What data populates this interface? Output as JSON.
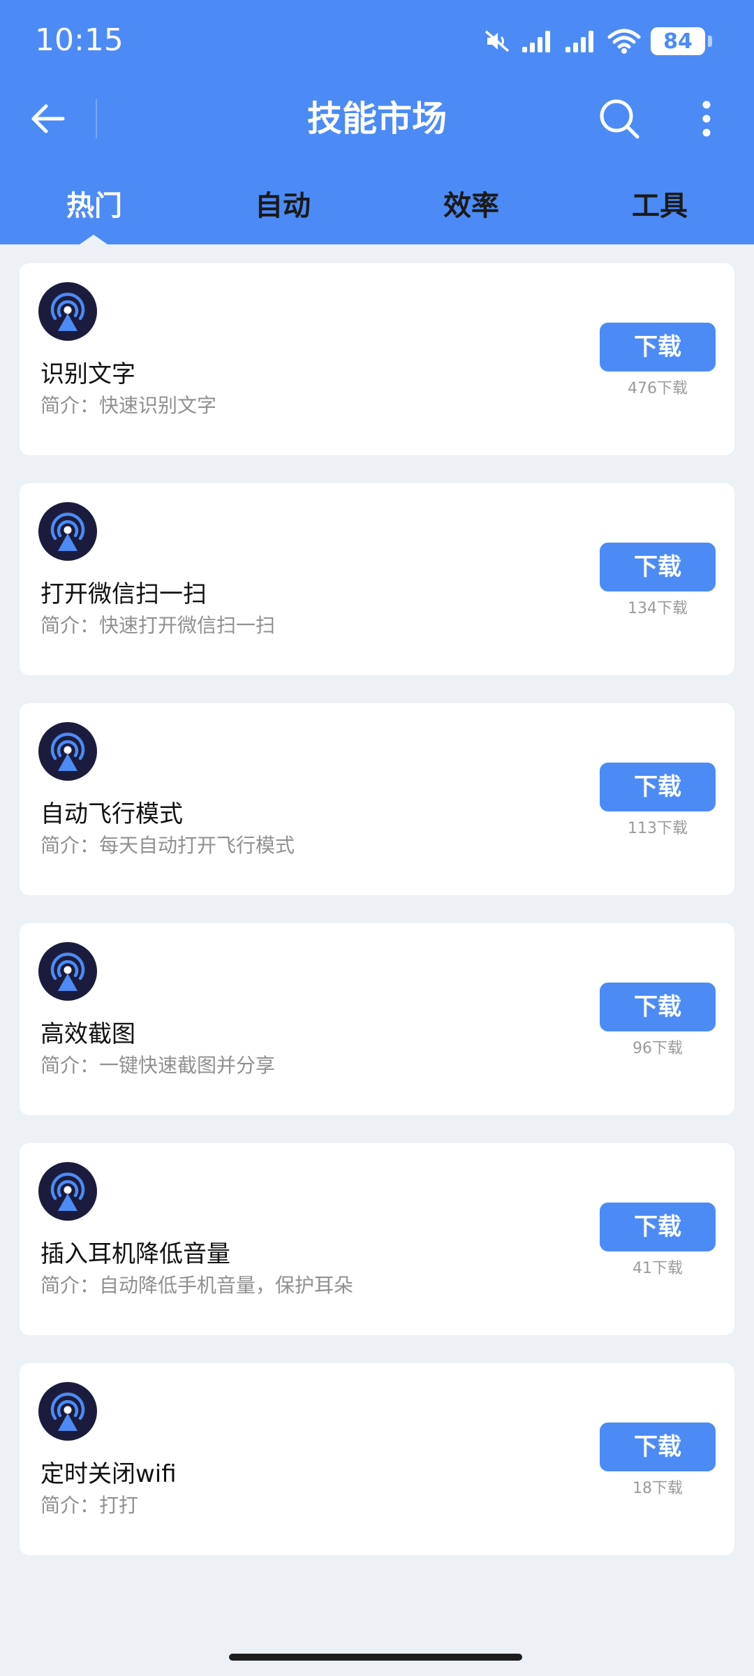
{
  "status_bar": {
    "time": "10:15",
    "battery": "84"
  },
  "header": {
    "title": "技能市场"
  },
  "tabs": [
    {
      "label": "热门",
      "active": true
    },
    {
      "label": "自动",
      "active": false
    },
    {
      "label": "效率",
      "active": false
    },
    {
      "label": "工具",
      "active": false
    }
  ],
  "skills": [
    {
      "title": "识别文字",
      "desc": "简介：快速识别文字",
      "button": "下载",
      "downloads": "476下载"
    },
    {
      "title": "打开微信扫一扫",
      "desc": "简介：快速打开微信扫一扫",
      "button": "下载",
      "downloads": "134下载"
    },
    {
      "title": "自动飞行模式",
      "desc": "简介：每天自动打开飞行模式",
      "button": "下载",
      "downloads": "113下载"
    },
    {
      "title": "高效截图",
      "desc": "简介：一键快速截图并分享",
      "button": "下载",
      "downloads": "96下载"
    },
    {
      "title": "插入耳机降低音量",
      "desc": "简介：自动降低手机音量，保护耳朵",
      "button": "下载",
      "downloads": "41下载"
    },
    {
      "title": "定时关闭wifi",
      "desc": "简介：打打",
      "button": "下载",
      "downloads": "18下载"
    }
  ],
  "colors": {
    "header_bg": "#4c8bf5",
    "page_bg": "#ecf1f5",
    "icon_bg": "#1b1c3d",
    "icon_accent": "#4c8bf5"
  },
  "icons": {
    "back": "arrow-left-icon",
    "search": "search-icon",
    "more": "more-vertical-icon",
    "skill": "broadcast-icon"
  }
}
